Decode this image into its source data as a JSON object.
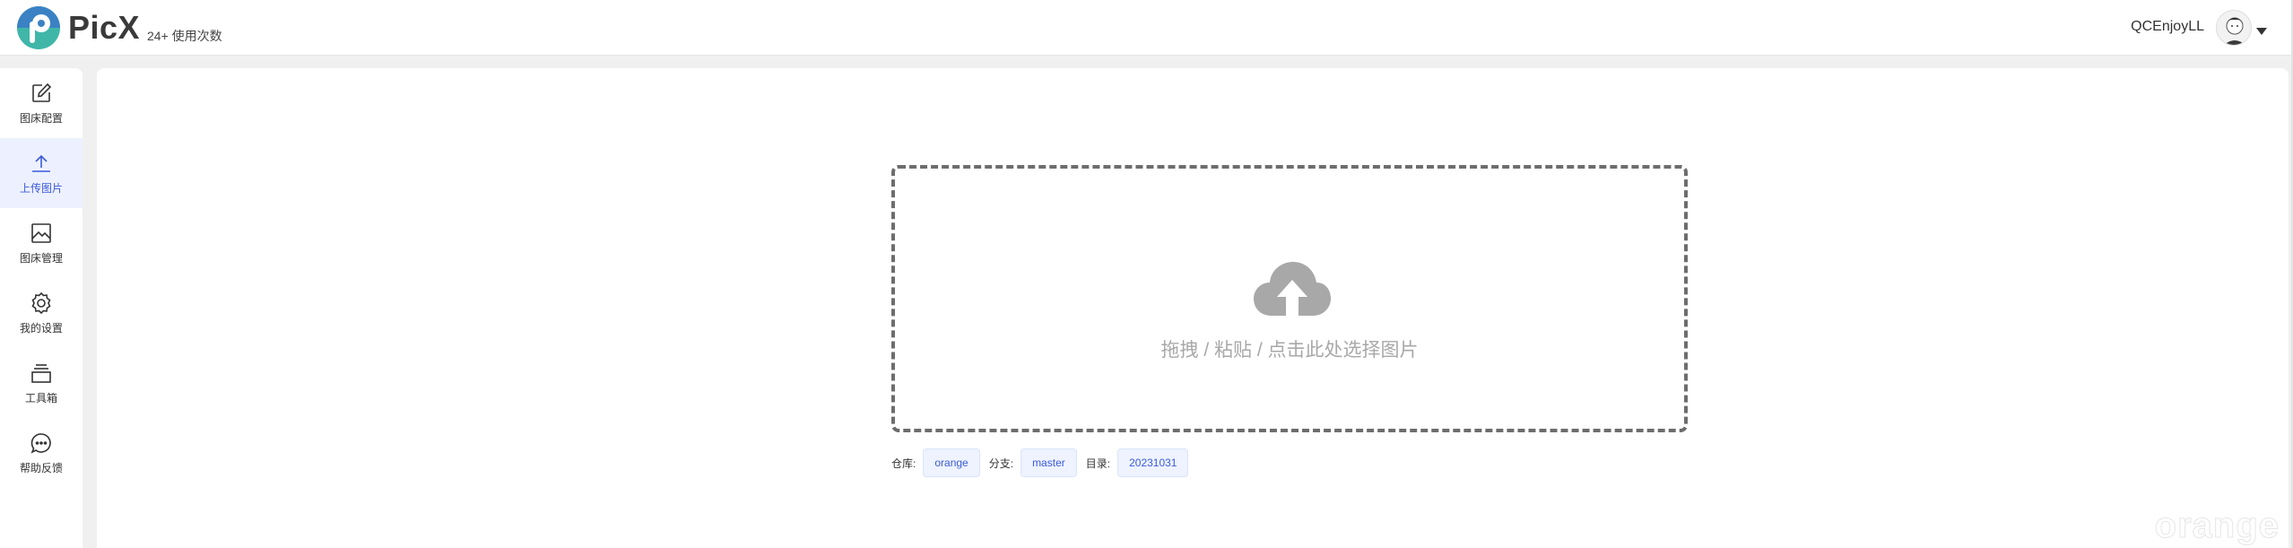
{
  "header": {
    "app_name": "PicX",
    "usage_text": "24+ 使用次数",
    "username": "QCEnjoyLL",
    "logo_icon": "picx-logo-icon",
    "avatar_icon": "user-avatar",
    "caret_icon": "caret-down-icon"
  },
  "sidebar": {
    "items": [
      {
        "label": "图床配置",
        "icon": "edit-icon",
        "active": false
      },
      {
        "label": "上传图片",
        "icon": "upload-icon",
        "active": true
      },
      {
        "label": "图床管理",
        "icon": "image-icon",
        "active": false
      },
      {
        "label": "我的设置",
        "icon": "gear-icon",
        "active": false
      },
      {
        "label": "工具箱",
        "icon": "toolbox-icon",
        "active": false
      },
      {
        "label": "帮助反馈",
        "icon": "chat-icon",
        "active": false
      }
    ]
  },
  "upload": {
    "drop_text": "拖拽 / 粘贴 / 点击此处选择图片",
    "cloud_icon": "cloud-upload-icon"
  },
  "repo_info": {
    "repo_label": "仓库:",
    "repo_value": "orange",
    "branch_label": "分支:",
    "branch_value": "master",
    "dir_label": "目录:",
    "dir_value": "20231031"
  },
  "watermark": "orange",
  "colors": {
    "accent": "#3b5bdb",
    "active_bg": "#edf1ff",
    "page_bg": "#f0f0f0",
    "tag_bg": "#eef3ff",
    "cloud": "#a8a8a8"
  }
}
